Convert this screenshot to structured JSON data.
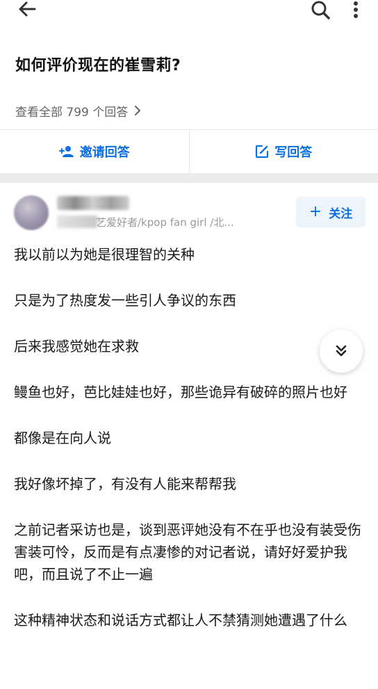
{
  "topbar": {
    "back_icon": "arrow-left-icon",
    "search_icon": "search-icon",
    "more_icon": "more-vertical-icon"
  },
  "question": {
    "title": "如何评价现在的崔雪莉?",
    "view_all": "查看全部 799 个回答"
  },
  "actions": {
    "invite_label": "邀请回答",
    "write_label": "写回答",
    "accent_color": "#0a6fe0"
  },
  "author": {
    "bio": "艺爱好者/kpop fan girl /北...",
    "follow_label": "关注"
  },
  "answer": {
    "paragraphs": [
      "我以前以为她是很理智的关种",
      "只是为了热度发一些引人争议的东西",
      "后来我感觉她在求救",
      "鳗鱼也好，芭比娃娃也好，那些诡异有破碎的照片也好",
      "都像是在向人说",
      "我好像坏掉了，有没有人能来帮帮我",
      "之前记者采访也是，谈到恶评她没有不在乎也没有装受伤害装可怜，反而是有点凄惨的对记者说，请好好爱护我吧，而且说了不止一遍",
      "这种精神状态和说话方式都让人不禁猜测她遭遇了什么"
    ]
  }
}
